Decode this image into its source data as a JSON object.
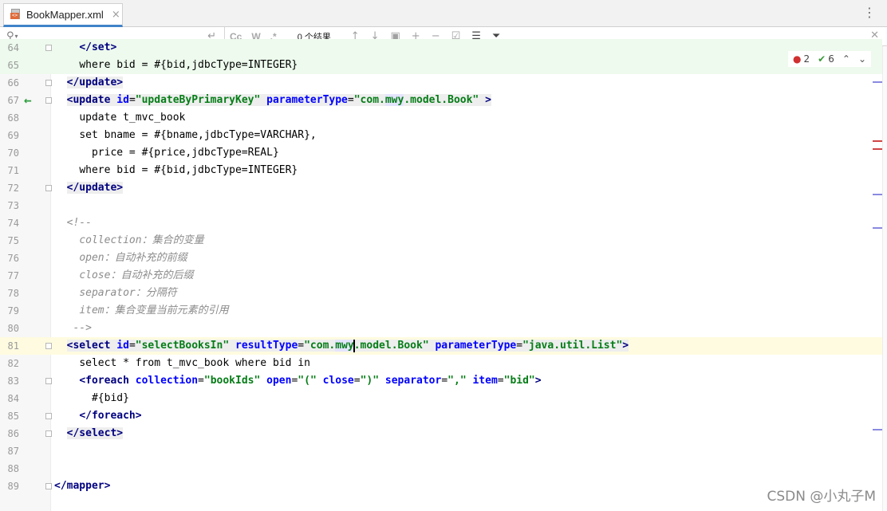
{
  "tab": {
    "label": "BookMapper.xml",
    "close": "×",
    "file_icon": "xml-file-icon"
  },
  "search": {
    "placeholder": "",
    "value": "",
    "results": "0 个结果",
    "match_case": "Cc",
    "words": "W",
    "regex": ".*"
  },
  "inspection": {
    "errors": "2",
    "ok": "6"
  },
  "colors": {
    "tag": "#000080",
    "attribute": "#0000ff",
    "string": "#067d17",
    "comment": "#8c8c8c",
    "changed_line_bg": "#edfaed",
    "current_line_bg": "#fffbe0"
  },
  "lines": [
    {
      "n": "64",
      "tokens": [
        [
          "t",
          "</set>"
        ]
      ],
      "indent": "  "
    },
    {
      "n": "65",
      "tokens": [
        [
          "p",
          "where bid = #{bid,jdbcType=INTEGER}"
        ]
      ],
      "indent": "  "
    },
    {
      "n": "66",
      "tokens": [
        [
          "t",
          "</update>"
        ]
      ],
      "indent": ""
    },
    {
      "n": "67",
      "tokens": [
        [
          "t",
          "<update "
        ],
        [
          "a",
          "id"
        ],
        [
          "p",
          "="
        ],
        [
          "s",
          "\"updateByPrimaryKey\""
        ],
        [
          "p",
          " "
        ],
        [
          "a",
          "parameterType"
        ],
        [
          "p",
          "="
        ],
        [
          "s",
          "\"com.mwy.model.Book\""
        ],
        [
          "p",
          " "
        ],
        [
          "t",
          ">"
        ]
      ],
      "indent": ""
    },
    {
      "n": "68",
      "tokens": [
        [
          "p",
          "update t_mvc_book"
        ]
      ],
      "indent": "  "
    },
    {
      "n": "69",
      "tokens": [
        [
          "p",
          "set bname = #{bname,jdbcType=VARCHAR},"
        ]
      ],
      "indent": "  "
    },
    {
      "n": "70",
      "tokens": [
        [
          "p",
          "price = #{price,jdbcType=REAL}"
        ]
      ],
      "indent": "    "
    },
    {
      "n": "71",
      "tokens": [
        [
          "p",
          "where bid = #{bid,jdbcType=INTEGER}"
        ]
      ],
      "indent": "  "
    },
    {
      "n": "72",
      "tokens": [
        [
          "t",
          "</update>"
        ]
      ],
      "indent": ""
    },
    {
      "n": "73",
      "tokens": [],
      "indent": ""
    },
    {
      "n": "74",
      "tokens": [
        [
          "c",
          "<!--"
        ]
      ],
      "indent": ""
    },
    {
      "n": "75",
      "tokens": [
        [
          "c",
          "collection：集合的变量"
        ]
      ],
      "indent": "  "
    },
    {
      "n": "76",
      "tokens": [
        [
          "c",
          "open：自动补充的前缀"
        ]
      ],
      "indent": "  "
    },
    {
      "n": "77",
      "tokens": [
        [
          "c",
          "close：自动补充的后缀"
        ]
      ],
      "indent": "  "
    },
    {
      "n": "78",
      "tokens": [
        [
          "c",
          "separator：分隔符"
        ]
      ],
      "indent": "  "
    },
    {
      "n": "79",
      "tokens": [
        [
          "c",
          "item：集合变量当前元素的引用"
        ]
      ],
      "indent": "  "
    },
    {
      "n": "80",
      "tokens": [
        [
          "c",
          "-->"
        ]
      ],
      "indent": " "
    },
    {
      "n": "81",
      "tokens": [
        [
          "t",
          "<select "
        ],
        [
          "a",
          "id"
        ],
        [
          "p",
          "="
        ],
        [
          "s",
          "\"selectBooksIn\""
        ],
        [
          "p",
          " "
        ],
        [
          "a",
          "resultType"
        ],
        [
          "p",
          "="
        ],
        [
          "s",
          "\"com.mwy.model.Book\""
        ],
        [
          "p",
          " "
        ],
        [
          "a",
          "parameterType"
        ],
        [
          "p",
          "="
        ],
        [
          "s",
          "\"java.util.List\""
        ],
        [
          "t",
          ">"
        ]
      ],
      "indent": ""
    },
    {
      "n": "82",
      "tokens": [
        [
          "p",
          "select * from t_mvc_book where bid in"
        ]
      ],
      "indent": "  "
    },
    {
      "n": "83",
      "tokens": [
        [
          "t",
          "<foreach "
        ],
        [
          "a",
          "collection"
        ],
        [
          "p",
          "="
        ],
        [
          "s",
          "\"bookIds\""
        ],
        [
          "p",
          " "
        ],
        [
          "a",
          "open"
        ],
        [
          "p",
          "="
        ],
        [
          "s",
          "\"(\""
        ],
        [
          "p",
          " "
        ],
        [
          "a",
          "close"
        ],
        [
          "p",
          "="
        ],
        [
          "s",
          "\")\""
        ],
        [
          "p",
          " "
        ],
        [
          "a",
          "separator"
        ],
        [
          "p",
          "="
        ],
        [
          "s",
          "\",\""
        ],
        [
          "p",
          " "
        ],
        [
          "a",
          "item"
        ],
        [
          "p",
          "="
        ],
        [
          "s",
          "\"bid\""
        ],
        [
          "t",
          ">"
        ]
      ],
      "indent": "  "
    },
    {
      "n": "84",
      "tokens": [
        [
          "p",
          "#{bid}"
        ]
      ],
      "indent": "    "
    },
    {
      "n": "85",
      "tokens": [
        [
          "t",
          "</foreach>"
        ]
      ],
      "indent": "  "
    },
    {
      "n": "86",
      "tokens": [
        [
          "t",
          "</select>"
        ]
      ],
      "indent": ""
    },
    {
      "n": "87",
      "tokens": [],
      "indent": ""
    },
    {
      "n": "88",
      "tokens": [],
      "indent": ""
    },
    {
      "n": "89",
      "tokens": [
        [
          "t",
          "</mapper>"
        ]
      ],
      "indent": ""
    }
  ],
  "watermark": "CSDN @小丸子M"
}
